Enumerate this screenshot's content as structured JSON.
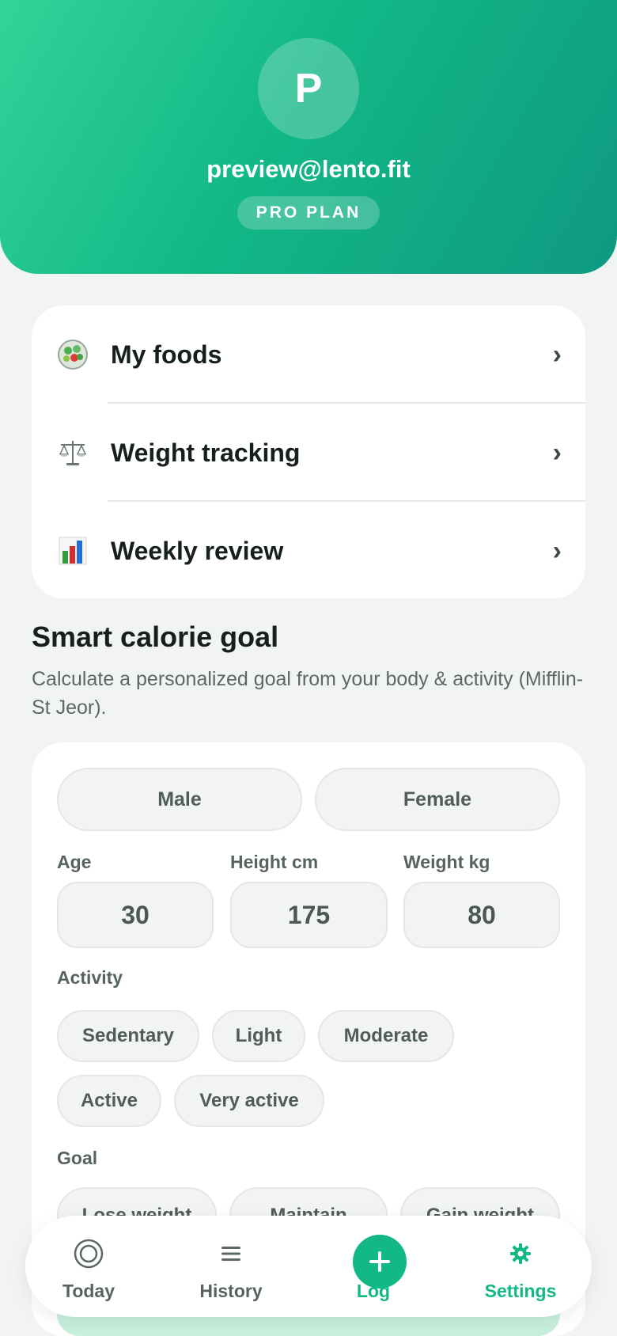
{
  "header": {
    "avatar_initial": "P",
    "email": "preview@lento.fit",
    "plan": "PRO PLAN"
  },
  "menu": {
    "items": [
      {
        "label": "My foods",
        "icon": "salad-bowl-icon"
      },
      {
        "label": "Weight tracking",
        "icon": "balance-scale-icon"
      },
      {
        "label": "Weekly review",
        "icon": "bar-chart-icon"
      }
    ]
  },
  "calorie_goal": {
    "title": "Smart calorie goal",
    "description": "Calculate a personalized goal from your body & activity (Mifflin-St Jeor).",
    "sex_options": [
      "Male",
      "Female"
    ],
    "age_label": "Age",
    "age_value": "30",
    "height_label": "Height cm",
    "height_value": "175",
    "weight_label": "Weight kg",
    "weight_value": "80",
    "activity_label": "Activity",
    "activity_options": [
      "Sedentary",
      "Light",
      "Moderate",
      "Active",
      "Very active"
    ],
    "goal_label": "Goal",
    "goal_options": [
      "Lose weight",
      "Maintain",
      "Gain weight"
    ]
  },
  "tabbar": {
    "tabs": [
      {
        "label": "Today",
        "icon": "target-circle-icon"
      },
      {
        "label": "History",
        "icon": "list-lines-icon"
      },
      {
        "label": "Log",
        "icon": "plus-icon"
      },
      {
        "label": "Settings",
        "icon": "gear-icon"
      }
    ],
    "active": "Settings"
  },
  "colors": {
    "accent": "#12b886",
    "header_gradient_start": "#34d399",
    "header_gradient_end": "#0f9982",
    "background": "#f1f4f3"
  }
}
